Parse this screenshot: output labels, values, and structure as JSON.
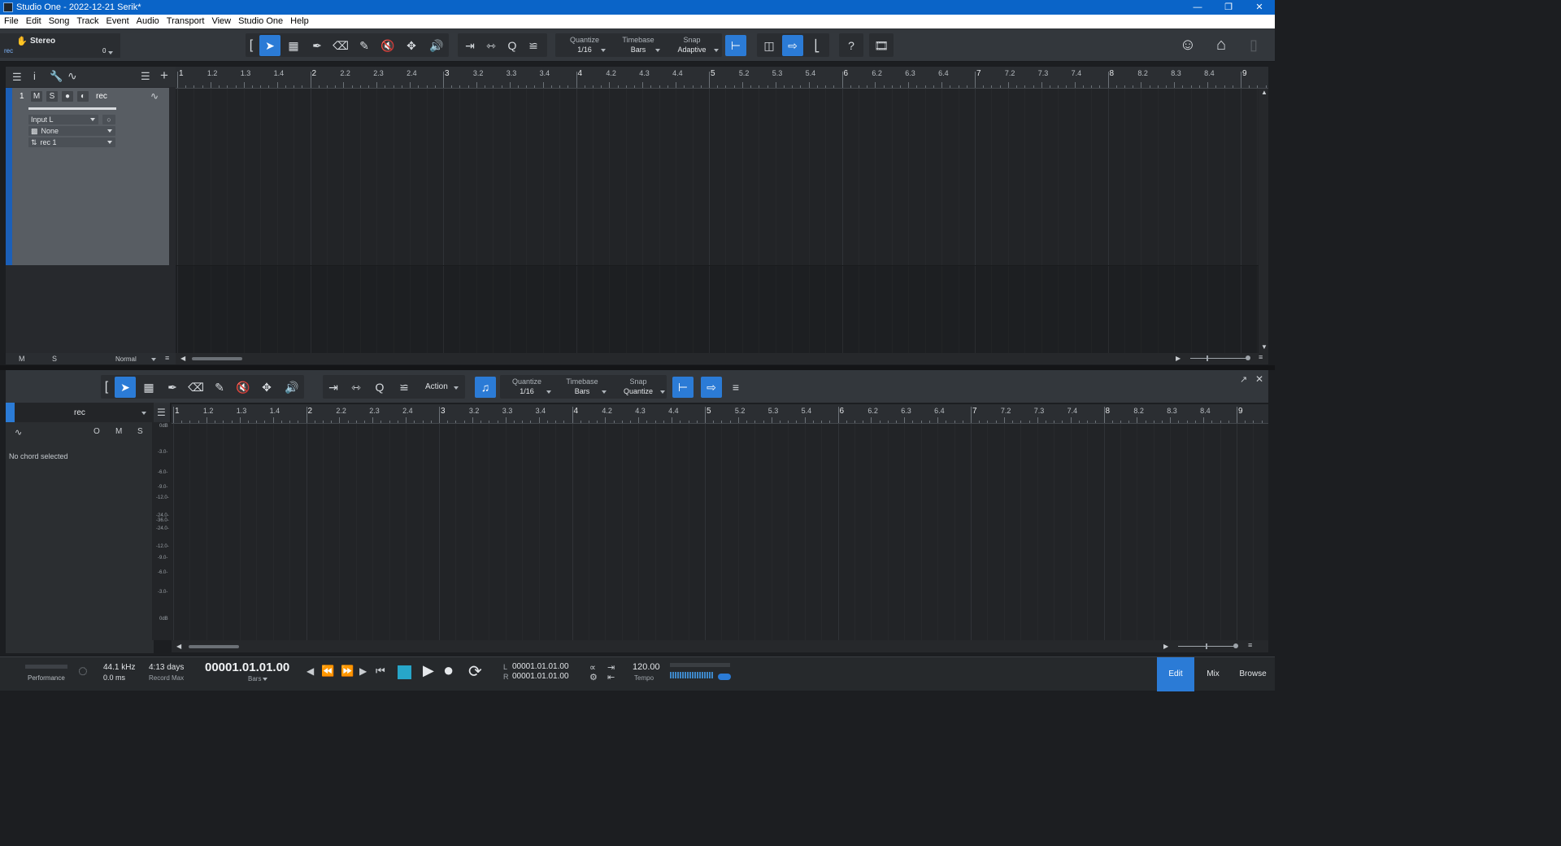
{
  "window": {
    "title": "Studio One - 2022-12-21 Serik*",
    "controls": [
      "minimize",
      "restore",
      "close"
    ]
  },
  "menu": [
    "File",
    "Edit",
    "Song",
    "Track",
    "Event",
    "Audio",
    "Transport",
    "View",
    "Studio One",
    "Help"
  ],
  "inspector_header": {
    "channel": "Stereo",
    "track": "rec",
    "value": "0"
  },
  "toolbar": {
    "quantize": {
      "label": "Quantize",
      "value": "1/16"
    },
    "timebase": {
      "label": "Timebase",
      "value": "Bars"
    },
    "snap": {
      "label": "Snap",
      "value": "Adaptive"
    },
    "help": "?"
  },
  "track": {
    "number": "1",
    "mute": "M",
    "solo": "S",
    "name": "rec",
    "input": "Input L",
    "output_none": "None",
    "channel": "rec 1"
  },
  "track_footer": {
    "m": "M",
    "s": "S",
    "mode": "Normal"
  },
  "ruler_labels": [
    "1",
    "1.2",
    "1.3",
    "1.4",
    "2",
    "2.2",
    "2.3",
    "2.4",
    "3",
    "3.2",
    "3.3",
    "3.4",
    "4",
    "4.2",
    "4.3",
    "4.4",
    "5",
    "5.2",
    "5.3",
    "5.4",
    "6",
    "6.2",
    "6.3",
    "6.4",
    "7",
    "7.2",
    "7.3",
    "7.4",
    "8",
    "8.2",
    "8.3",
    "8.4",
    "9"
  ],
  "editor": {
    "action": "Action",
    "quantize": {
      "label": "Quantize",
      "value": "1/16"
    },
    "timebase": {
      "label": "Timebase",
      "value": "Bars"
    },
    "snap": {
      "label": "Snap",
      "value": "Quantize"
    },
    "track_name": "rec",
    "chord_text": "No chord selected",
    "buttons": {
      "o": "O",
      "m": "M",
      "s": "S"
    },
    "scale": [
      "0dB",
      "-3.0-",
      "-6.0-",
      "-9.0-",
      "-12.0-",
      "-24.0-",
      "-36.0-",
      "-24.0-",
      "-12.0-",
      "-9.0-",
      "-6.0-",
      "-3.0-",
      "0dB"
    ]
  },
  "status": {
    "performance": "Performance",
    "sample_rate": "44.1 kHz",
    "latency": "0.0 ms",
    "record_max": "4:13 days",
    "record_max_label": "Record Max",
    "position": "00001.01.01.00",
    "position_unit": "Bars",
    "loop_l": "00001.01.01.00",
    "loop_r": "00001.01.01.00",
    "l": "L",
    "r": "R",
    "tempo": "120.00",
    "tempo_label": "Tempo",
    "tabs": [
      "Edit",
      "Mix",
      "Browse"
    ]
  }
}
